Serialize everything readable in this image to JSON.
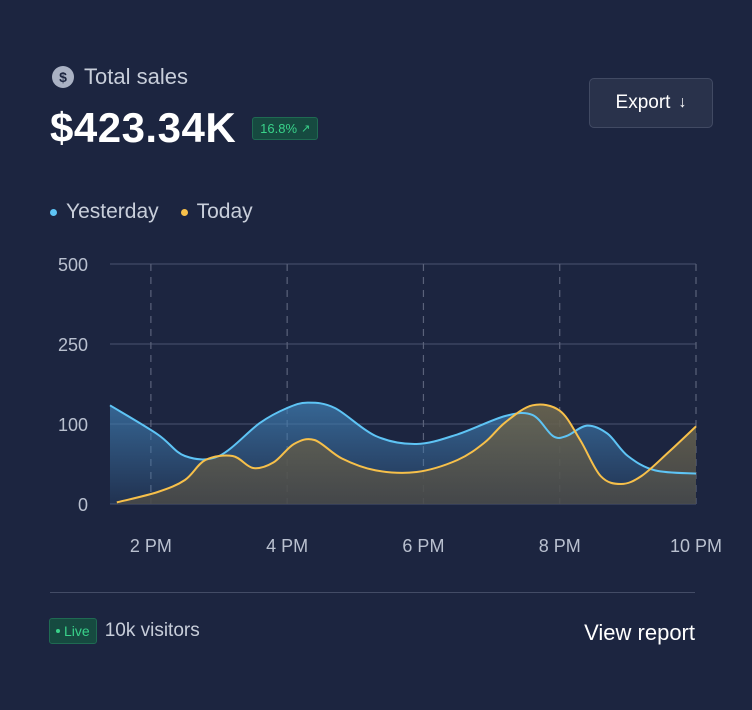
{
  "header": {
    "title_icon": "dollar-icon",
    "title": "Total sales",
    "amount": "$423.34K",
    "change": "16.8%",
    "change_icon": "arrow-up-right-icon",
    "export_label": "Export",
    "export_icon": "arrow-down-icon"
  },
  "footer": {
    "live_label": "Live",
    "visitors": "10k visitors",
    "view_report": "View report"
  },
  "colors": {
    "background": "#1c2540",
    "yesterday": "#5ec4f5",
    "today": "#f7c04a",
    "badge_green": "#39d28a"
  },
  "chart_data": {
    "type": "area",
    "x_ticks": [
      "2 PM",
      "4 PM",
      "6 PM",
      "8 PM",
      "10 PM"
    ],
    "y_ticks": [
      "0",
      "100",
      "250",
      "500"
    ],
    "y_scale": "piecewise (gridlines at 0, 100, 250, 500 evenly spaced)",
    "xlim_hours": [
      13.4,
      22
    ],
    "grid": {
      "horizontal": "solid",
      "vertical": "dashed"
    },
    "legend_position": "top-left",
    "series": [
      {
        "name": "Yesterday",
        "color": "#5ec4f5",
        "x": [
          13.4,
          14.1,
          14.5,
          15.0,
          15.6,
          16.0,
          16.3,
          16.7,
          17.3,
          17.9,
          18.5,
          19.2,
          19.6,
          19.9,
          20.1,
          20.4,
          20.7,
          21.0,
          21.4,
          22.0
        ],
        "y": [
          135,
          87,
          60,
          60,
          102,
          130,
          140,
          130,
          85,
          75,
          87,
          115,
          117,
          85,
          85,
          98,
          88,
          60,
          42,
          38
        ]
      },
      {
        "name": "Today",
        "color": "#f7c04a",
        "x": [
          13.5,
          14.1,
          14.5,
          14.8,
          15.2,
          15.5,
          15.8,
          16.1,
          16.4,
          16.8,
          17.3,
          17.9,
          18.5,
          18.9,
          19.2,
          19.6,
          20.0,
          20.3,
          20.6,
          20.9,
          21.2,
          21.6,
          22.0
        ],
        "y": [
          2,
          15,
          30,
          55,
          60,
          45,
          52,
          75,
          80,
          57,
          42,
          40,
          55,
          77,
          103,
          135,
          125,
          80,
          35,
          25,
          35,
          65,
          97
        ]
      }
    ]
  }
}
